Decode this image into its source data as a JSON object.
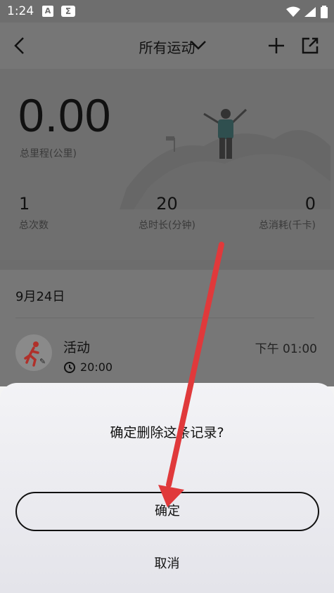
{
  "status_bar": {
    "time": "1:24",
    "notif_icons": [
      "a-icon",
      "sigma-icon"
    ],
    "right_icons": [
      "wifi-icon",
      "signal-icon",
      "battery-icon"
    ]
  },
  "nav": {
    "back_icon": "chevron-left-icon",
    "title": "所有运动",
    "title_icon": "chevron-down-icon",
    "add_icon": "plus-icon",
    "share_icon": "share-icon"
  },
  "summary": {
    "total_distance": "0.00",
    "total_distance_label": "总里程(公里)",
    "stats": [
      {
        "value": "1",
        "label": "总次数"
      },
      {
        "value": "20",
        "label": "总时长(分钟)"
      },
      {
        "value": "0",
        "label": "总消耗(千卡)"
      }
    ]
  },
  "records": {
    "date": "9月24日",
    "items": [
      {
        "name": "活动",
        "time": "下午 01:00",
        "duration": "20:00",
        "icon": "running-person-icon"
      }
    ]
  },
  "dialog": {
    "message": "确定删除这条记录?",
    "confirm_label": "确定",
    "cancel_label": "取消"
  },
  "colors": {
    "overlay_gray": "#6f6f6f",
    "sheet_bg": "#eeeef2",
    "arrow_red": "#e0393b",
    "activity_red": "#c0392b"
  }
}
